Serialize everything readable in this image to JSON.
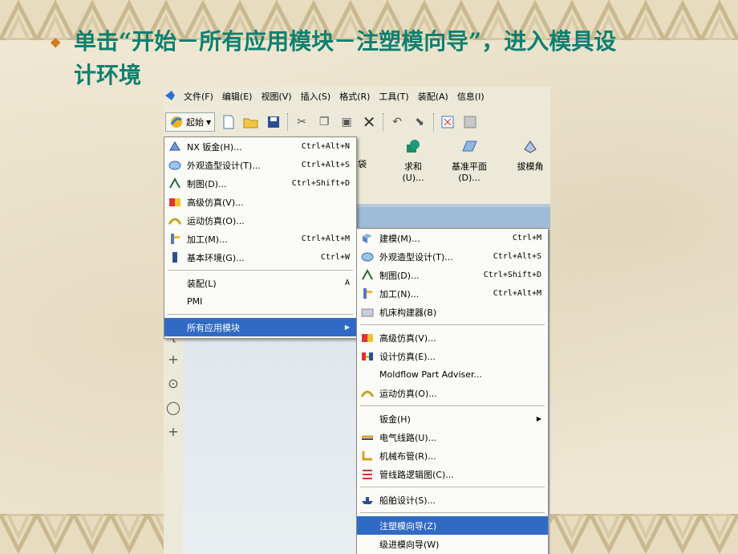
{
  "slide": {
    "line1": "单击“开始－所有应用模块－注塑模向导”，进入模具设",
    "line2": "计环境"
  },
  "menubar": [
    {
      "label": "文件(F)"
    },
    {
      "label": "编辑(E)"
    },
    {
      "label": "视图(V)"
    },
    {
      "label": "插入(S)"
    },
    {
      "label": "格式(R)"
    },
    {
      "label": "工具(T)"
    },
    {
      "label": "装配(A)"
    },
    {
      "label": "信息(I)"
    }
  ],
  "toolbar": {
    "start_label": "起始"
  },
  "ribbon": [
    {
      "label": "求和",
      "sub": "(U)..."
    },
    {
      "label": "基准平面",
      "sub": "(D)..."
    },
    {
      "label": "拔模角",
      "sub": ""
    }
  ],
  "start_menu": [
    {
      "icon": "sheet-metal-icon",
      "label": "NX 钣金(H)...",
      "shortcut": "Ctrl+Alt+N"
    },
    {
      "icon": "shape-studio-icon",
      "label": "外观造型设计(T)...",
      "shortcut": "Ctrl+Alt+S"
    },
    {
      "icon": "drafting-icon",
      "label": "制图(D)...",
      "shortcut": "Ctrl+Shift+D"
    },
    {
      "icon": "advanced-sim-icon",
      "label": "高级仿真(V)...",
      "shortcut": ""
    },
    {
      "icon": "motion-icon",
      "label": "运动仿真(O)...",
      "shortcut": ""
    },
    {
      "icon": "machining-icon",
      "label": "加工(M)...",
      "shortcut": "Ctrl+Alt+M"
    },
    {
      "icon": "gateway-icon",
      "label": "基本环境(G)...",
      "shortcut": "Ctrl+W"
    },
    {
      "sep": true
    },
    {
      "icon": "",
      "label": "装配(L)",
      "shortcut": "A"
    },
    {
      "icon": "",
      "label": "PMI",
      "shortcut": ""
    },
    {
      "sep": true
    },
    {
      "icon": "",
      "label": "所有应用模块",
      "shortcut": "",
      "submenu": true,
      "highlight": true
    }
  ],
  "apps_menu": [
    {
      "icon": "modeling-icon",
      "label": "建模(M)...",
      "shortcut": "Ctrl+M"
    },
    {
      "icon": "shape-studio-icon",
      "label": "外观造型设计(T)...",
      "shortcut": "Ctrl+Alt+S"
    },
    {
      "icon": "drafting-icon",
      "label": "制图(D)...",
      "shortcut": "Ctrl+Shift+D"
    },
    {
      "icon": "machining-icon",
      "label": "加工(N)...",
      "shortcut": "Ctrl+Alt+M"
    },
    {
      "icon": "machine-builder-icon",
      "label": "机床构建器(B)",
      "shortcut": ""
    },
    {
      "sep": true
    },
    {
      "icon": "advanced-sim-icon",
      "label": "高级仿真(V)...",
      "shortcut": ""
    },
    {
      "icon": "design-sim-icon",
      "label": "设计仿真(E)...",
      "shortcut": ""
    },
    {
      "icon": "",
      "label": "Moldflow Part Adviser...",
      "shortcut": ""
    },
    {
      "icon": "motion-icon",
      "label": "运动仿真(O)...",
      "shortcut": ""
    },
    {
      "sep": true
    },
    {
      "icon": "",
      "label": "钣金(H)",
      "shortcut": "",
      "submenu": true
    },
    {
      "icon": "wiring-icon",
      "label": "电气线路(U)...",
      "shortcut": ""
    },
    {
      "icon": "piping-icon",
      "label": "机械布管(R)...",
      "shortcut": ""
    },
    {
      "icon": "routing-diagram-icon",
      "label": "管线路逻辑图(C)...",
      "shortcut": ""
    },
    {
      "sep": true
    },
    {
      "icon": "ship-icon",
      "label": "船舶设计(S)...",
      "shortcut": ""
    },
    {
      "sep": true
    },
    {
      "icon": "",
      "label": "注塑模向导(Z)",
      "shortcut": "",
      "highlight": true
    },
    {
      "icon": "",
      "label": "级进模向导(W)",
      "shortcut": ""
    }
  ]
}
